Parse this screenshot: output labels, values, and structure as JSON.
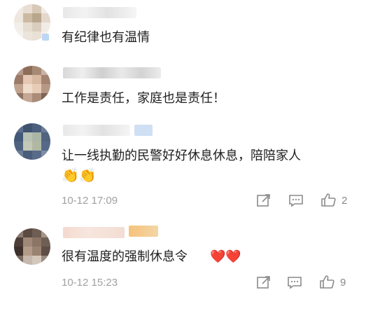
{
  "comments": [
    {
      "text": "有纪律也有温情"
    },
    {
      "text": "工作是责任，家庭也是责任！"
    },
    {
      "text": "让一线执勤的民警好好休息休息，陪陪家人",
      "emoji": "👏👏",
      "time": "10-12 17:09",
      "likes": "2",
      "icons": [
        "share-icon",
        "comment-icon",
        "like-icon"
      ]
    },
    {
      "text": "很有温度的强制休息令",
      "hearts": "❤️❤️",
      "time": "10-12 15:23",
      "likes": "9",
      "icons": [
        "share-icon",
        "comment-icon",
        "like-icon"
      ]
    }
  ],
  "colors": {
    "meta": "#a0a0a0",
    "heart": "#e8402f",
    "text": "#1f1f1f"
  }
}
